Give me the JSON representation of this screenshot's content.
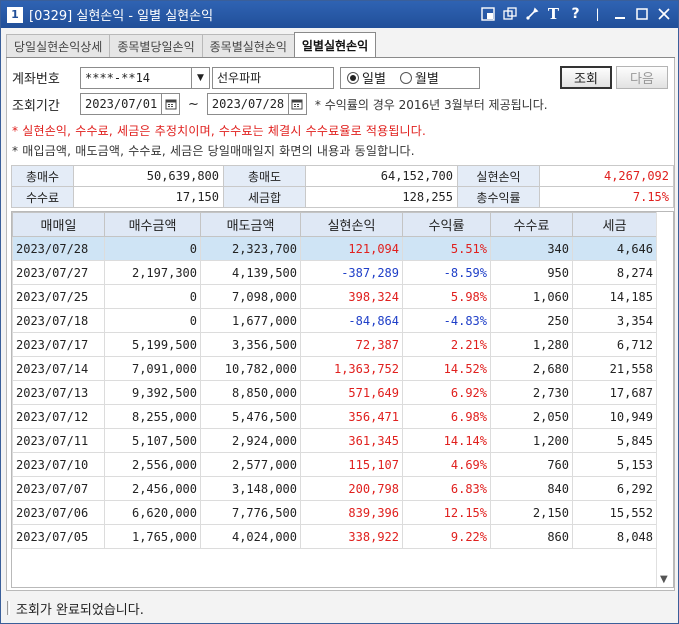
{
  "window": {
    "number": "1",
    "title": "[0329] 실현손익 - 일별 실현손익"
  },
  "tabs": [
    {
      "label": "당일실현손익상세"
    },
    {
      "label": "종목별당일손익"
    },
    {
      "label": "종목별실현손익"
    },
    {
      "label": "일별실현손익"
    }
  ],
  "form": {
    "account_label": "계좌번호",
    "account_value": "****-**14",
    "account_name": "선우파파",
    "radio_daily": "일별",
    "radio_monthly": "월별",
    "query_button": "조회",
    "next_button": "다음",
    "period_label": "조회기간",
    "date_from": "2023/07/01",
    "date_sep": "~",
    "date_to": "2023/07/28",
    "period_note": "* 수익률의 경우 2016년 3월부터 제공됩니다."
  },
  "notes": {
    "warning": "* 실현손익, 수수료, 세금은 추정치이며, 수수료는 체결시 수수료율로 적용됩니다.",
    "info": "* 매입금액, 매도금액, 수수료, 세금은 당일매매일지 화면의 내용과 동일합니다."
  },
  "summary": {
    "total_buy_label": "총매수",
    "total_buy": "50,639,800",
    "total_sell_label": "총매도",
    "total_sell": "64,152,700",
    "realized_label": "실현손익",
    "realized": "4,267,092",
    "fee_label": "수수료",
    "fee": "17,150",
    "tax_label": "세금합",
    "tax": "128,255",
    "total_return_label": "총수익률",
    "total_return": "7.15%"
  },
  "grid": {
    "columns": [
      "매매일",
      "매수금액",
      "매도금액",
      "실현손익",
      "수익률",
      "수수료",
      "세금"
    ],
    "rows": [
      [
        "2023/07/28",
        "0",
        "2,323,700",
        "121,094",
        "5.51%",
        "340",
        "4,646"
      ],
      [
        "2023/07/27",
        "2,197,300",
        "4,139,500",
        "-387,289",
        "-8.59%",
        "950",
        "8,274"
      ],
      [
        "2023/07/25",
        "0",
        "7,098,000",
        "398,324",
        "5.98%",
        "1,060",
        "14,185"
      ],
      [
        "2023/07/18",
        "0",
        "1,677,000",
        "-84,864",
        "-4.83%",
        "250",
        "3,354"
      ],
      [
        "2023/07/17",
        "5,199,500",
        "3,356,500",
        "72,387",
        "2.21%",
        "1,280",
        "6,712"
      ],
      [
        "2023/07/14",
        "7,091,000",
        "10,782,000",
        "1,363,752",
        "14.52%",
        "2,680",
        "21,558"
      ],
      [
        "2023/07/13",
        "9,392,500",
        "8,850,000",
        "571,649",
        "6.92%",
        "2,730",
        "17,687"
      ],
      [
        "2023/07/12",
        "8,255,000",
        "5,476,500",
        "356,471",
        "6.98%",
        "2,050",
        "10,949"
      ],
      [
        "2023/07/11",
        "5,107,500",
        "2,924,000",
        "361,345",
        "14.14%",
        "1,200",
        "5,845"
      ],
      [
        "2023/07/10",
        "2,556,000",
        "2,577,000",
        "115,107",
        "4.69%",
        "760",
        "5,153"
      ],
      [
        "2023/07/07",
        "2,456,000",
        "3,148,000",
        "200,798",
        "6.83%",
        "840",
        "6,292"
      ],
      [
        "2023/07/06",
        "6,620,000",
        "7,776,500",
        "839,396",
        "12.15%",
        "2,150",
        "15,552"
      ],
      [
        "2023/07/05",
        "1,765,000",
        "4,024,000",
        "338,922",
        "9.22%",
        "860",
        "8,048"
      ]
    ]
  },
  "status": {
    "message": "조회가 완료되었습니다."
  },
  "colors": {
    "profit": "#e0201e",
    "loss": "#1f3fc8",
    "title_bar": "#214f99",
    "selected_row": "#cfe4f5"
  }
}
